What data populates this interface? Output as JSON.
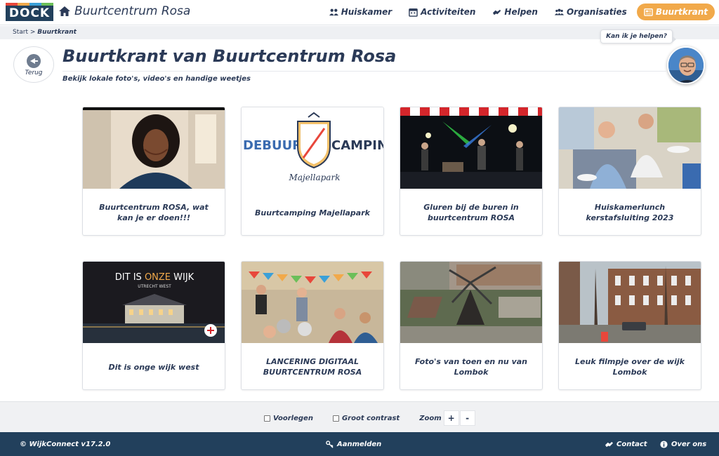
{
  "header": {
    "logo_text": "DOCK",
    "site_title": "Buurtcentrum Rosa",
    "nav": [
      {
        "label": "Huiskamer",
        "icon": "people-icon"
      },
      {
        "label": "Activiteiten",
        "icon": "calendar-icon"
      },
      {
        "label": "Helpen",
        "icon": "handshake-icon"
      },
      {
        "label": "Organisaties",
        "icon": "group-icon"
      },
      {
        "label": "Buurtkrant",
        "icon": "newspaper-icon",
        "active": true
      }
    ],
    "colors": {
      "active": "#f1a94a",
      "navy": "#22405c",
      "logo_bars": [
        "#e8473b",
        "#f1a94a",
        "#3aa0d8",
        "#6bbf59"
      ]
    }
  },
  "breadcrumb": {
    "home": "Start",
    "separator": ">",
    "current": "Buurtkrant"
  },
  "helper": {
    "bubble": "Kan ik je helpen?"
  },
  "back": {
    "label": "Terug"
  },
  "page": {
    "title": "Buurtkrant van Buurtcentrum Rosa",
    "subtitle": "Bekijk lokale foto's, video's en handige weetjes"
  },
  "cards": [
    {
      "caption": "Buurtcentrum ROSA, wat kan je er doen!!!",
      "thumb": "woman-video"
    },
    {
      "caption": "Buurtcamping Majellapark",
      "thumb": "camping-logo",
      "logo_left": "DEBUURT",
      "logo_right": "CAMPING",
      "logo_sub": "Majellapark"
    },
    {
      "caption": "Gluren bij de buren in buurtcentrum ROSA",
      "thumb": "concert-stage"
    },
    {
      "caption": "Huiskamerlunch kerstafsluiting 2023",
      "thumb": "lunch-party"
    },
    {
      "caption": "Dit is onge wijk west",
      "thumb": "night-castle",
      "overlay_a": "DIT IS ",
      "overlay_b": "ONZE",
      "overlay_c": " WIJK",
      "overlay_sub": "UTRECHT WEST"
    },
    {
      "caption": "LANCERING DIGITAAL BUURTCENTRUM ROSA",
      "thumb": "launch-event"
    },
    {
      "caption": "Foto's van toen en nu van Lombok",
      "thumb": "windmill"
    },
    {
      "caption": "Leuk filmpje over de wijk Lombok",
      "thumb": "street"
    }
  ],
  "a11y": {
    "read_aloud": "Voorlegen",
    "contrast": "Groot contrast",
    "zoom": "Zoom",
    "zoom_in": "+",
    "zoom_out": "-"
  },
  "footer": {
    "copyright": "© WijkConnect v17.2.0",
    "login": "Aanmelden",
    "contact": "Contact",
    "about": "Over ons"
  }
}
